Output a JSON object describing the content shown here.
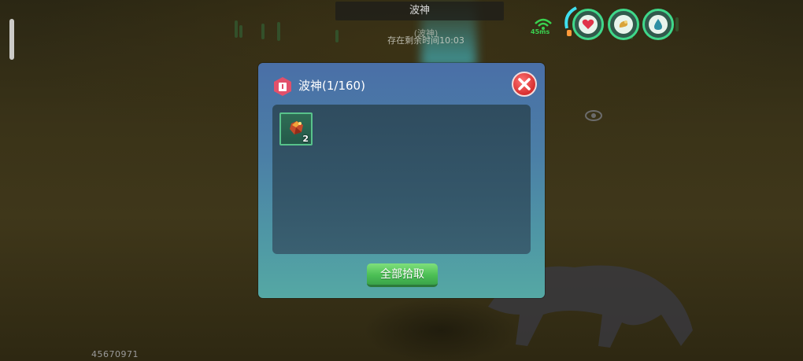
{
  "top_banner": {
    "title": "波神",
    "subtitle": "(波神)",
    "timer_text": "存在剩余时间10:03"
  },
  "network": {
    "ping": "45ms"
  },
  "stats": {
    "health_icon": "heart-icon",
    "hunger_icon": "meat-icon",
    "water_icon": "water-drop-icon"
  },
  "dialog": {
    "title": "波神(1/160)",
    "items": [
      {
        "icon": "ore-item-icon",
        "count": "2"
      }
    ],
    "pickup_all_label": "全部拾取"
  },
  "player_id": "45670971",
  "colors": {
    "dialog_top": "#4a6fa7",
    "dialog_bottom": "#55a8a4",
    "button_green": "#4cbf55",
    "close_red": "#d62f2f",
    "stat_ring": "#3fd88a"
  }
}
